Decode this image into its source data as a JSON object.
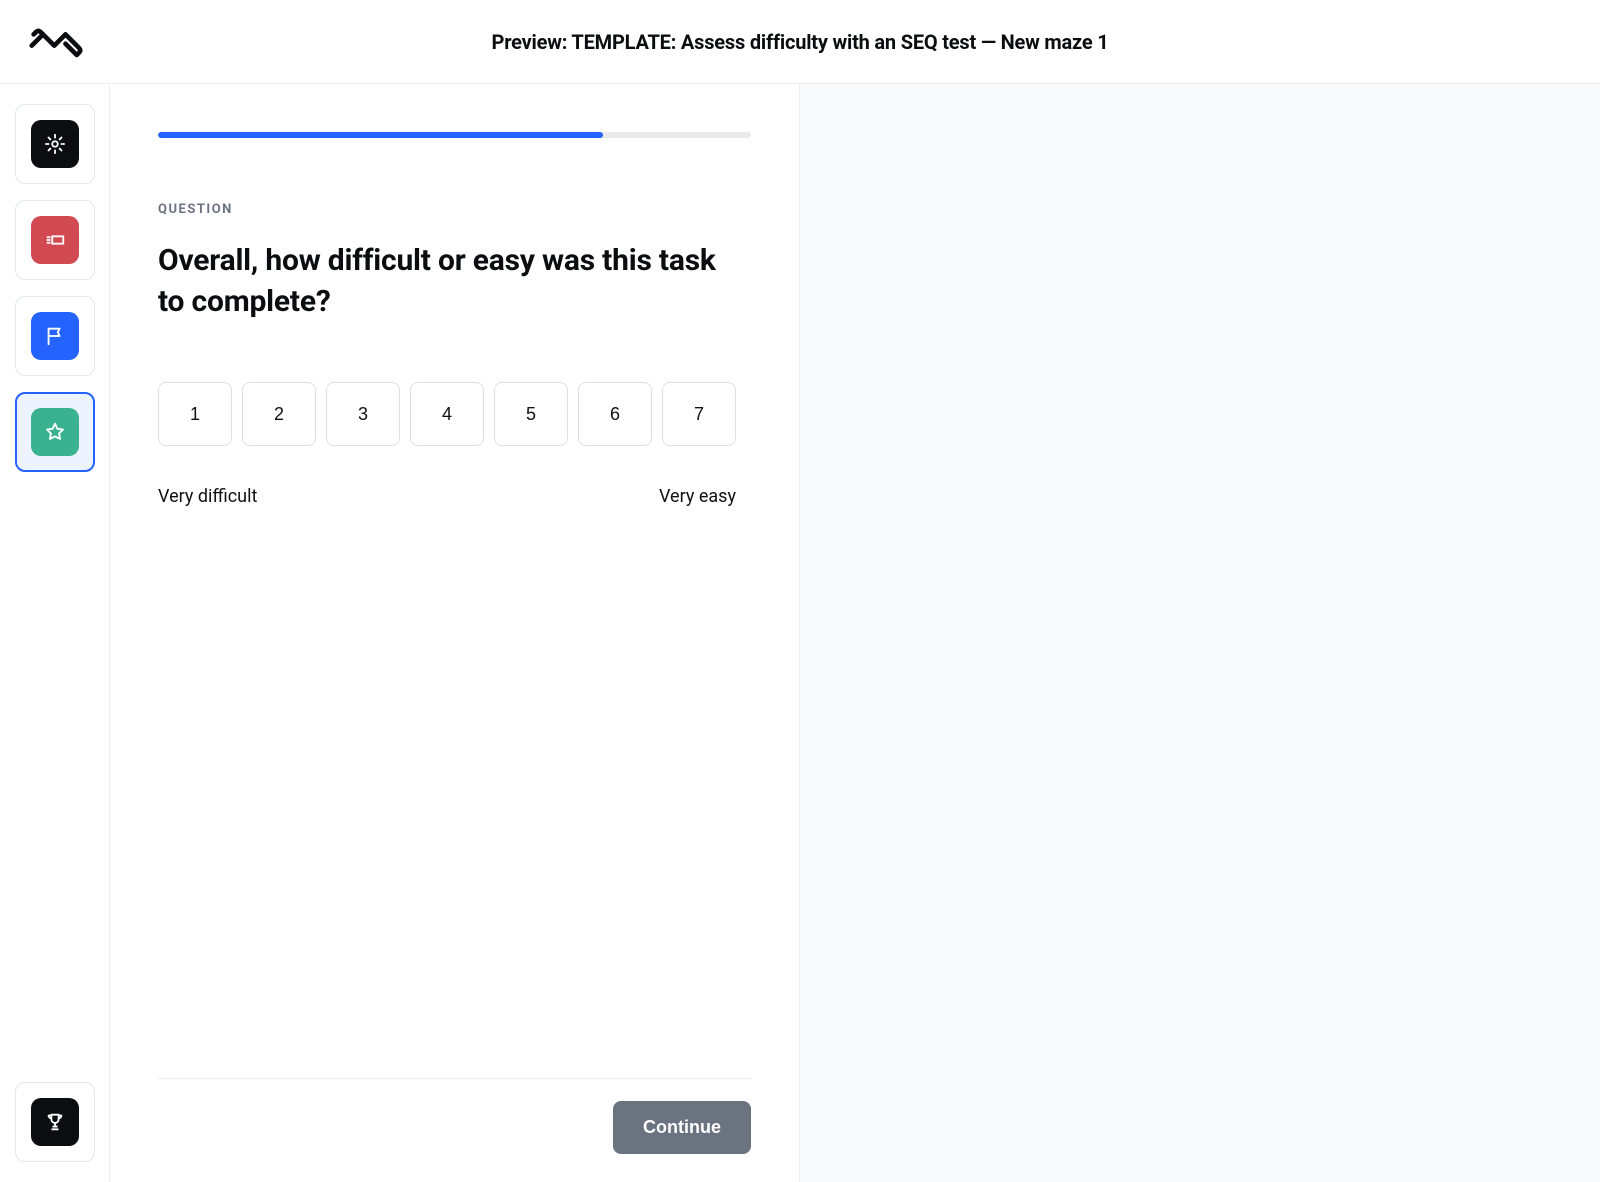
{
  "header": {
    "title": "Preview: TEMPLATE: Assess difficulty with an SEQ test — New maze 1"
  },
  "sidebar": {
    "items": [
      {
        "icon": "gear",
        "active": false,
        "chip": "dark",
        "name": "step-setup"
      },
      {
        "icon": "layout",
        "active": false,
        "chip": "red",
        "name": "step-block"
      },
      {
        "icon": "flag",
        "active": false,
        "chip": "blue",
        "name": "step-flag"
      },
      {
        "icon": "star",
        "active": true,
        "chip": "teal",
        "name": "step-rating"
      }
    ],
    "footer": {
      "icon": "trophy",
      "chip": "dark",
      "name": "step-finish"
    }
  },
  "main": {
    "progress_percent": 75,
    "eyebrow": "QUESTION",
    "question_text": "Overall, how difficult or easy was this task to complete?",
    "scale_values": [
      "1",
      "2",
      "3",
      "4",
      "5",
      "6",
      "7"
    ],
    "scale_min_label": "Very difficult",
    "scale_max_label": "Very easy",
    "continue_label": "Continue"
  }
}
